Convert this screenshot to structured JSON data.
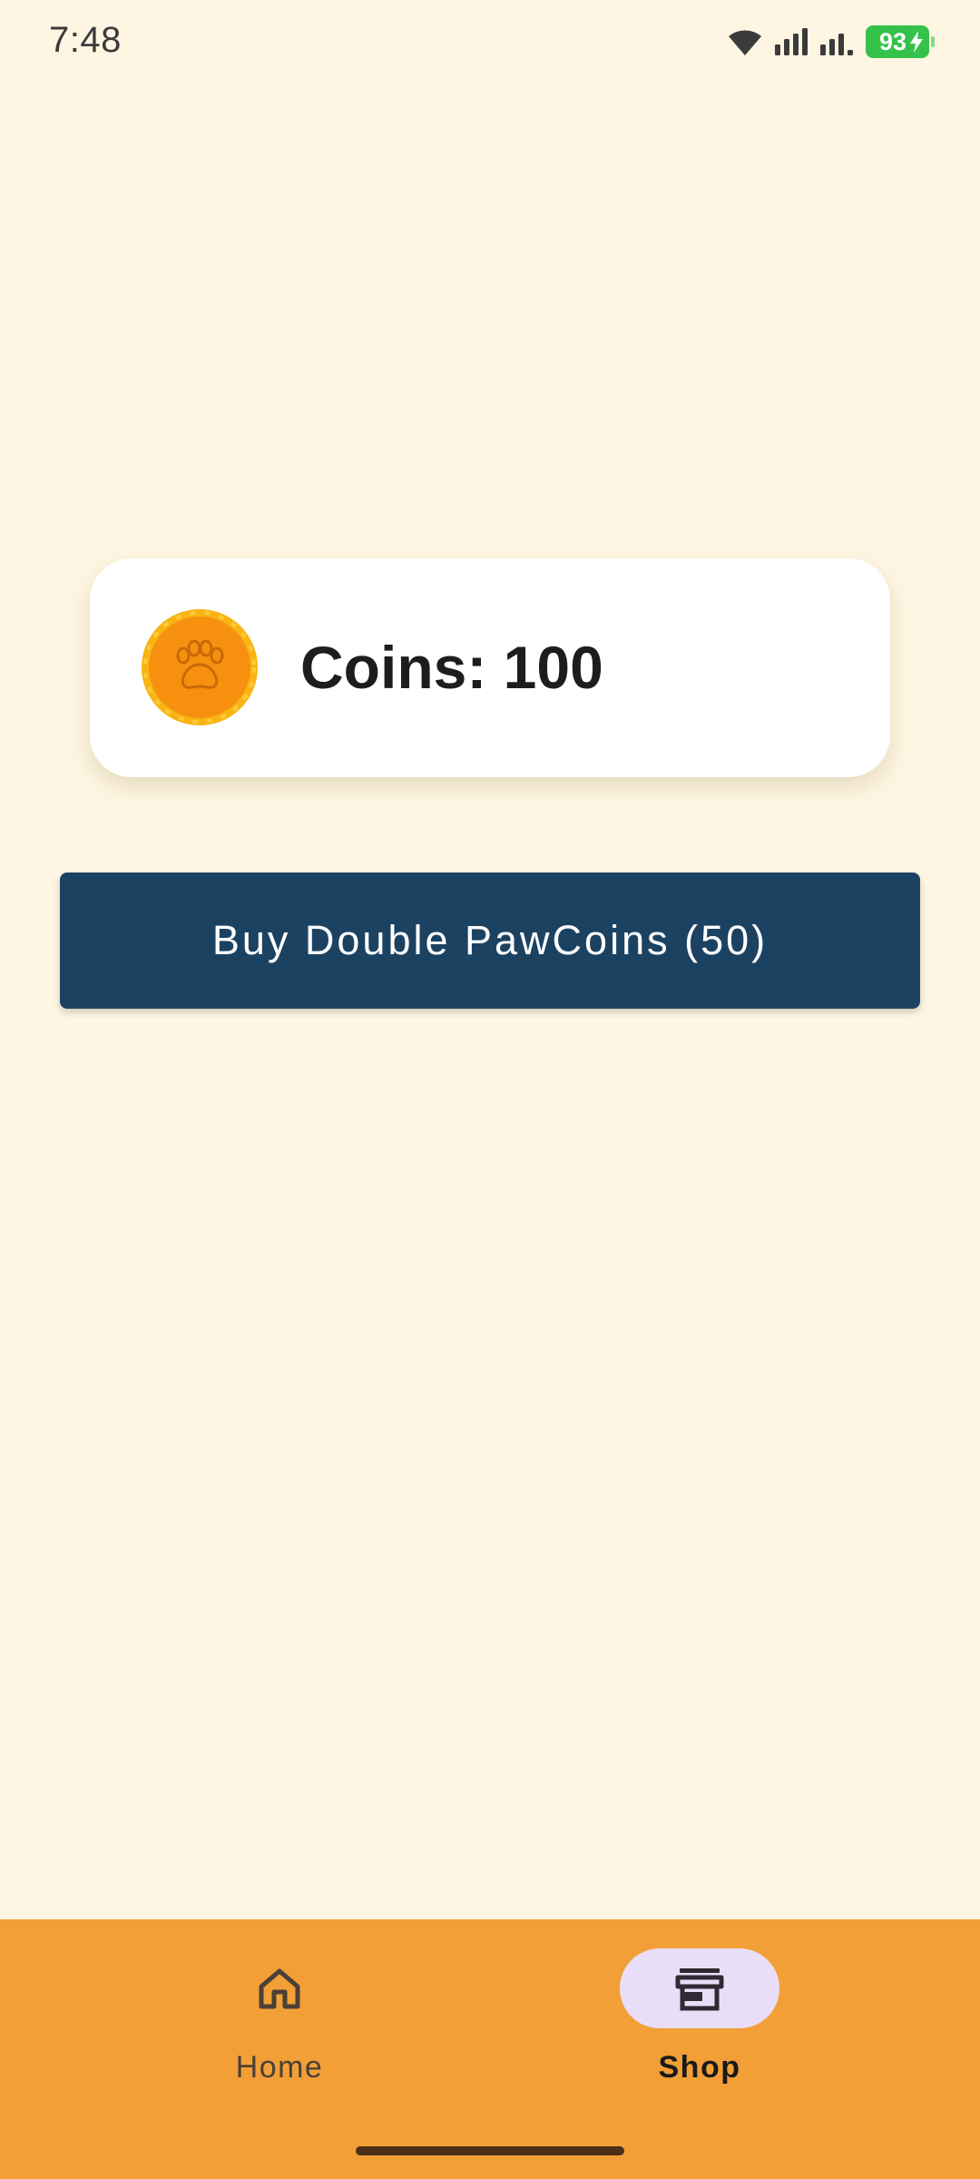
{
  "status_bar": {
    "time": "7:48",
    "battery_level": "93",
    "icons": [
      "wifi-icon",
      "signal-icon",
      "signal-icon",
      "battery-charging-icon"
    ]
  },
  "coins_card": {
    "icon": "paw-coin-icon",
    "text": "Coins: 100"
  },
  "buy_button": {
    "label": "Buy Double PawCoins (50)"
  },
  "bottom_nav": {
    "items": [
      {
        "label": "Home",
        "icon": "home-icon",
        "selected": false
      },
      {
        "label": "Shop",
        "icon": "store-icon",
        "selected": true
      }
    ]
  },
  "colors": {
    "background": "#FEF6E2",
    "nav_background": "#F29F38",
    "button_background": "#1C4262",
    "selected_pill": "#E9DEF8",
    "battery_green": "#35C24A",
    "coin_orange": "#F7900F"
  }
}
